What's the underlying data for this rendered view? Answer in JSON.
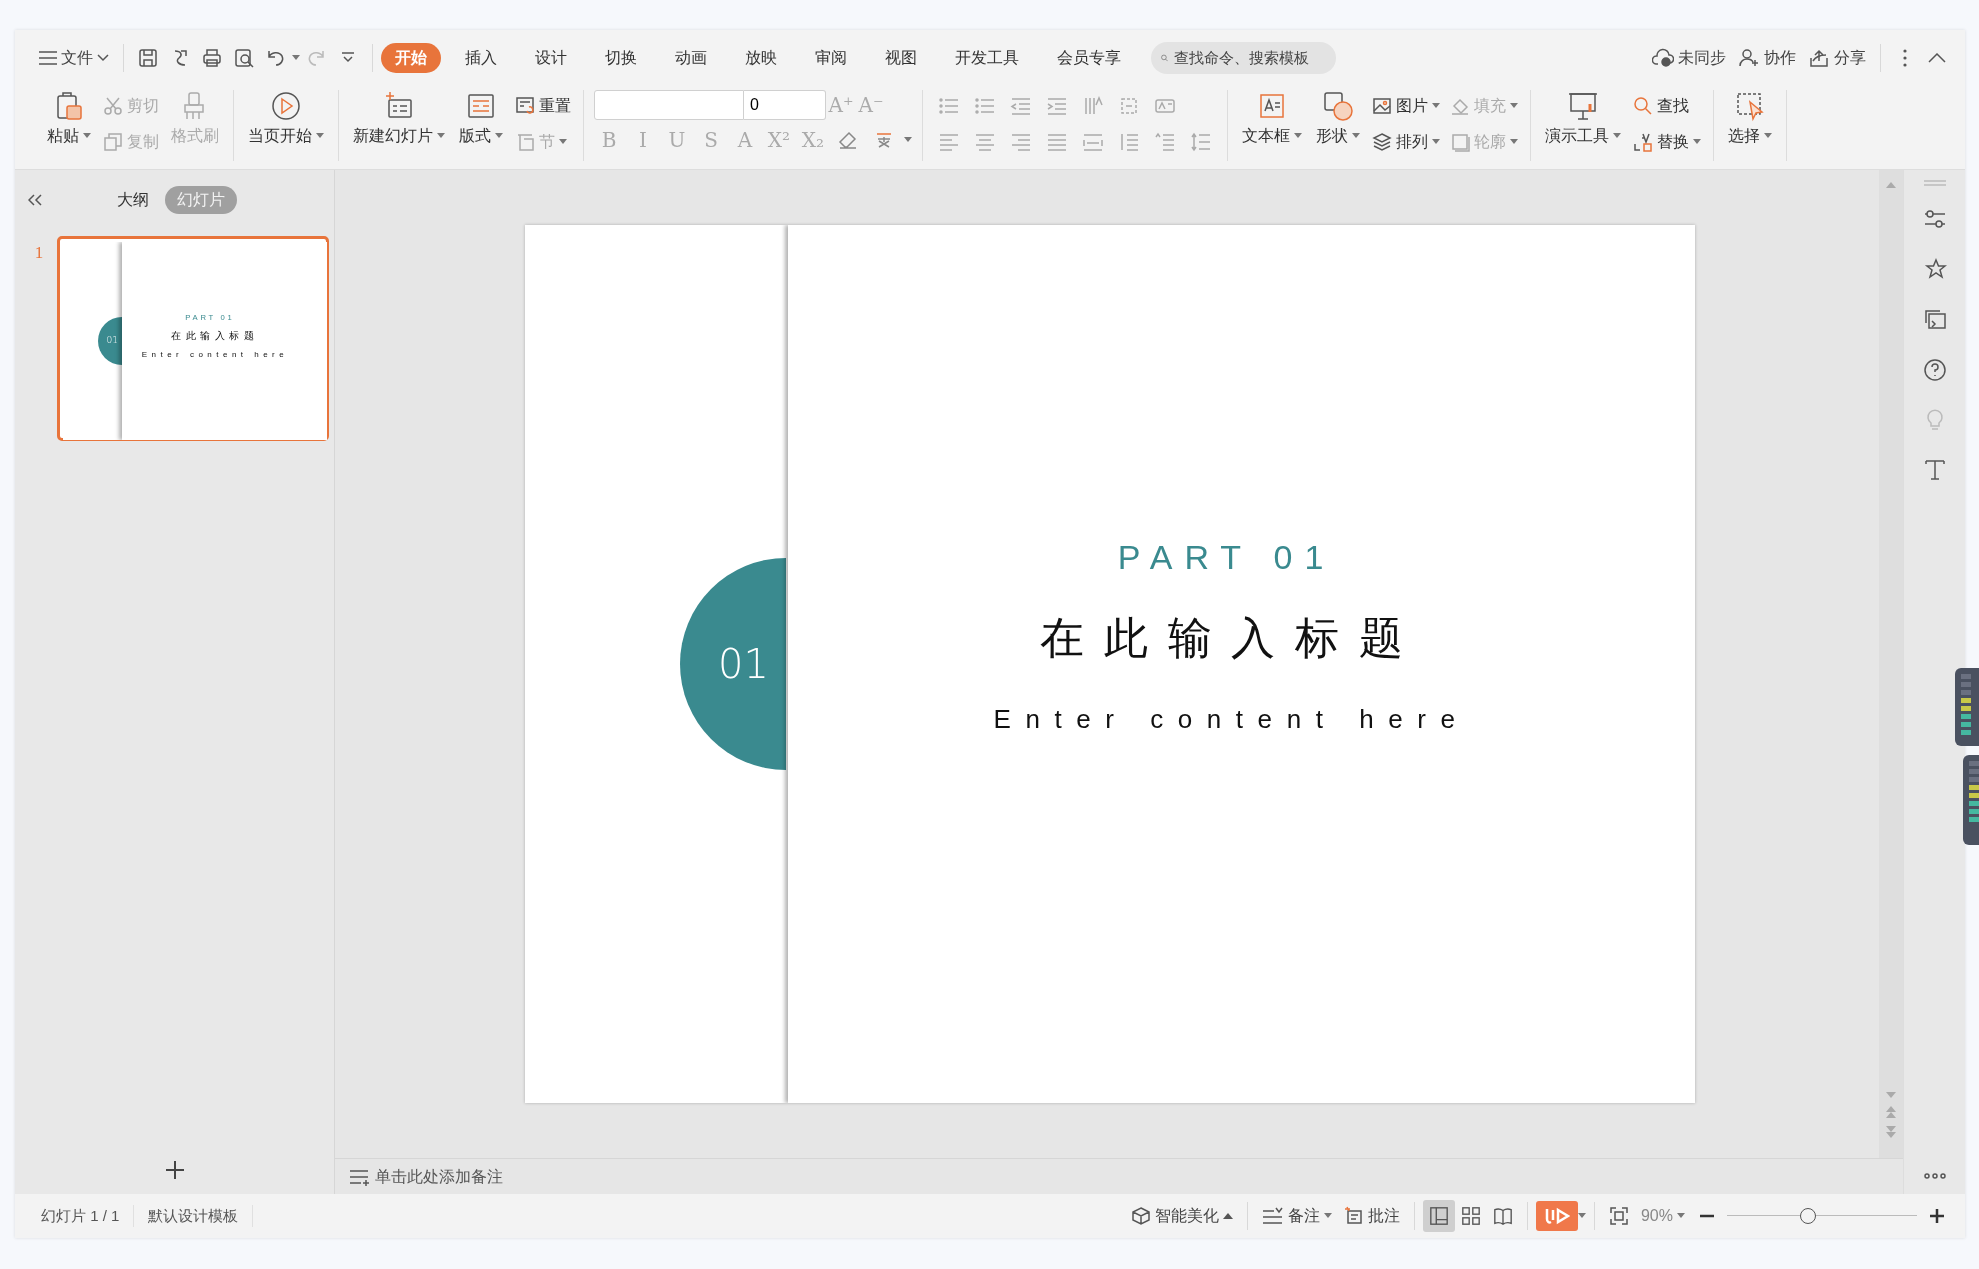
{
  "menu": {
    "label": "文件"
  },
  "tabs": [
    {
      "label": "开始",
      "selected": true
    },
    {
      "label": "插入",
      "selected": false
    },
    {
      "label": "设计",
      "selected": false
    },
    {
      "label": "切换",
      "selected": false
    },
    {
      "label": "动画",
      "selected": false
    },
    {
      "label": "放映",
      "selected": false
    },
    {
      "label": "审阅",
      "selected": false
    },
    {
      "label": "视图",
      "selected": false
    },
    {
      "label": "开发工具",
      "selected": false
    },
    {
      "label": "会员专享",
      "selected": false
    }
  ],
  "search": {
    "placeholder": "查找命令、搜索模板"
  },
  "header_actions": [
    {
      "label": "未同步"
    },
    {
      "label": "协作"
    },
    {
      "label": "分享"
    }
  ],
  "ribbon": [
    {
      "items": [
        {
          "kind": "large",
          "label": "粘贴",
          "dropdown": true,
          "disabled": false
        },
        {
          "kind": "column",
          "items": [
            {
              "label": "剪切",
              "dropdown": false,
              "disabled": true
            },
            {
              "label": "复制",
              "dropdown": false,
              "disabled": true
            }
          ]
        },
        {
          "kind": "large",
          "label": "格式刷",
          "dropdown": false,
          "disabled": true
        }
      ]
    },
    {
      "items": [
        {
          "kind": "large",
          "label": "当页开始",
          "dropdown": true,
          "disabled": false
        }
      ]
    },
    {
      "items": [
        {
          "kind": "large",
          "label": "新建幻灯片",
          "dropdown": true,
          "disabled": false
        },
        {
          "kind": "large",
          "label": "版式",
          "dropdown": true,
          "disabled": false
        },
        {
          "kind": "column",
          "items": [
            {
              "label": "重置",
              "dropdown": false,
              "disabled": false
            },
            {
              "label": "节",
              "dropdown": true,
              "disabled": true
            }
          ]
        }
      ]
    },
    {
      "items": [
        {
          "kind": "font",
          "size": "0",
          "sizing": [
            {
              "label": "A⁺",
              "disabled": true
            },
            {
              "label": "A⁻",
              "disabled": true
            }
          ],
          "buttons": [
            {
              "label": "B",
              "disabled": true
            },
            {
              "label": "I",
              "disabled": true
            },
            {
              "label": "U",
              "disabled": true
            },
            {
              "label": "S",
              "disabled": true
            },
            {
              "label": "A",
              "disabled": true
            },
            {
              "label": "X²",
              "disabled": true
            },
            {
              "label": "X₂",
              "disabled": true
            }
          ]
        }
      ]
    },
    {
      "items": [
        {
          "kind": "paragraph"
        }
      ]
    },
    {
      "items": [
        {
          "kind": "large",
          "label": "文本框",
          "dropdown": true,
          "disabled": false
        },
        {
          "kind": "large",
          "label": "形状",
          "dropdown": true,
          "disabled": false
        },
        {
          "kind": "column",
          "items": [
            {
              "label": "图片",
              "dropdown": true,
              "disabled": false
            },
            {
              "label": "排列",
              "dropdown": true,
              "disabled": false
            }
          ]
        },
        {
          "kind": "column",
          "items": [
            {
              "label": "填充",
              "dropdown": true,
              "disabled": true
            },
            {
              "label": "轮廓",
              "dropdown": true,
              "disabled": true
            }
          ]
        }
      ]
    },
    {
      "items": [
        {
          "kind": "large",
          "label": "演示工具",
          "dropdown": true,
          "disabled": false
        },
        {
          "kind": "column",
          "items": [
            {
              "label": "查找",
              "dropdown": false,
              "disabled": false
            },
            {
              "label": "替换",
              "dropdown": true,
              "disabled": false
            }
          ]
        }
      ]
    },
    {
      "items": [
        {
          "kind": "large",
          "label": "选择",
          "dropdown": true,
          "disabled": false
        }
      ]
    }
  ],
  "panel": {
    "tabs": [
      {
        "label": "大纲",
        "selected": false
      },
      {
        "label": "幻灯片",
        "selected": true
      }
    ],
    "slides": [
      {
        "number": "1",
        "selected": true,
        "part": "PART 01",
        "badge": "01",
        "title": "在此输入标题",
        "subtitle": "Enter content here"
      }
    ]
  },
  "slide": {
    "part": "PART 01",
    "badge": "01",
    "title": "在此输入标题",
    "subtitle": "Enter content here"
  },
  "notes": {
    "placeholder": "单击此处添加备注"
  },
  "status_bar": {
    "slide_info": "幻灯片 1 / 1",
    "template": "默认设计模板",
    "beautify": "智能美化",
    "notes": "备注",
    "comments": "批注",
    "views": [
      {
        "kind": "normal",
        "selected": true
      },
      {
        "kind": "sorter",
        "selected": false
      },
      {
        "kind": "reading",
        "selected": false
      }
    ],
    "zoom": "90%",
    "zoom_slider": {
      "level": 0.42
    }
  }
}
